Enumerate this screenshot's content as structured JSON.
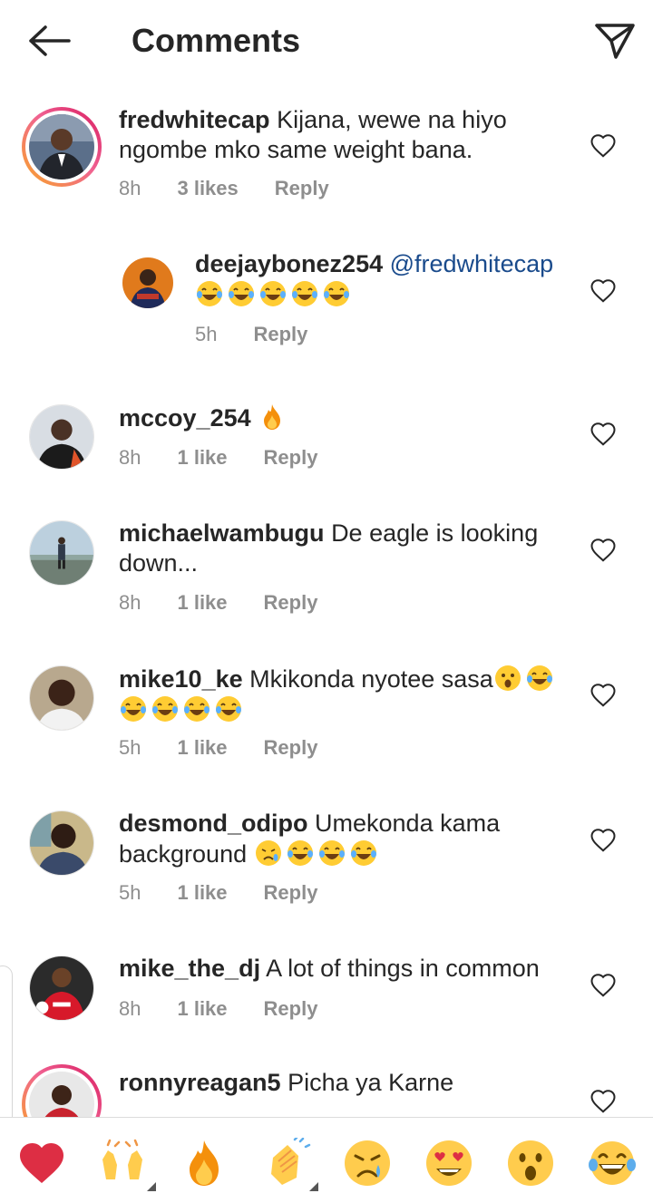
{
  "header": {
    "title": "Comments",
    "back_icon": "arrow-left-icon",
    "share_icon": "paper-plane-icon"
  },
  "comments": [
    {
      "username": "fredwhitecap",
      "text_line1": "Kijana, wewe na hiyo",
      "text_line2": "ngombe mko same weight bana.",
      "time": "8h",
      "likes": "3 likes",
      "reply": "Reply",
      "story_ring": true
    },
    {
      "username": "deejaybonez254",
      "mention": "@fredwhitecap",
      "emojis": [
        "tears-of-joy",
        "tears-of-joy",
        "tears-of-joy",
        "tears-of-joy",
        "tears-of-joy"
      ],
      "time": "5h",
      "reply": "Reply",
      "is_reply": true
    },
    {
      "username": "mccoy_254",
      "emojis": [
        "fire"
      ],
      "time": "8h",
      "likes": "1 like",
      "reply": "Reply"
    },
    {
      "username": "michaelwambugu",
      "text_line1": "De eagle is looking",
      "text_line2": "down...",
      "time": "8h",
      "likes": "1 like",
      "reply": "Reply"
    },
    {
      "username": "mike10_ke",
      "text_line1": "Mkikonda nyotee sasa",
      "emojis": [
        "astonished",
        "tears-of-joy",
        "tears-of-joy",
        "tears-of-joy",
        "tears-of-joy",
        "tears-of-joy"
      ],
      "time": "5h",
      "likes": "1 like",
      "reply": "Reply"
    },
    {
      "username": "desmond_odipo",
      "text_line1": "Umekonda kama",
      "text_line2": "background",
      "emojis": [
        "crying",
        "tears-of-joy",
        "tears-of-joy",
        "tears-of-joy"
      ],
      "time": "5h",
      "likes": "1 like",
      "reply": "Reply"
    },
    {
      "username": "mike_the_dj",
      "text_line1": "A lot of things in common",
      "time": "8h",
      "likes": "1 like",
      "reply": "Reply"
    },
    {
      "username": "ronnyreagan5",
      "text_line1": "Picha ya Karne",
      "story_ring": true
    }
  ],
  "reactions": [
    "red-heart",
    "raising-hands",
    "fire",
    "clapping-hands",
    "crying",
    "heart-eyes",
    "astonished",
    "tears-of-joy"
  ],
  "colors": {
    "text": "#262626",
    "meta": "#8e8e8e",
    "mention": "#1a4b8c",
    "heart": "#e0242e"
  }
}
